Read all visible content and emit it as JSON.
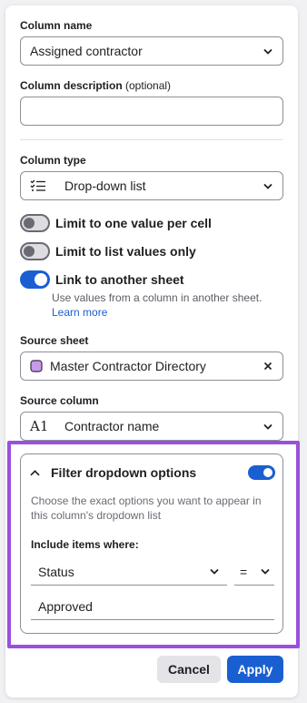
{
  "column_name": {
    "label": "Column name",
    "value": "Assigned contractor"
  },
  "column_description": {
    "label": "Column description",
    "optional_text": "(optional)",
    "value": ""
  },
  "column_type": {
    "label": "Column type",
    "value": "Drop-down list",
    "icon": "list-icon"
  },
  "toggles": [
    {
      "label": "Limit to one value per cell",
      "on": false
    },
    {
      "label": "Limit to list values only",
      "on": false
    },
    {
      "label": "Link to another sheet",
      "on": true
    }
  ],
  "link_help": {
    "text": "Use values from a column in another sheet.",
    "link": "Learn more"
  },
  "source_sheet": {
    "label": "Source sheet",
    "value": "Master Contractor Directory",
    "icon": "sheet-icon"
  },
  "source_column": {
    "label": "Source column",
    "value": "Contractor name",
    "icon": "text-column-icon",
    "icon_text": "A1"
  },
  "filter": {
    "title": "Filter dropdown options",
    "enabled": true,
    "description": "Choose the exact options you want to appear in this column's dropdown list",
    "include_label": "Include items where:",
    "field": "Status",
    "operator": "=",
    "value": "Approved"
  },
  "actions": {
    "cancel": "Cancel",
    "apply": "Apply"
  },
  "colors": {
    "accent": "#1a5fd1",
    "highlight": "#9a50dc",
    "sheet_icon": "#c79be8"
  }
}
